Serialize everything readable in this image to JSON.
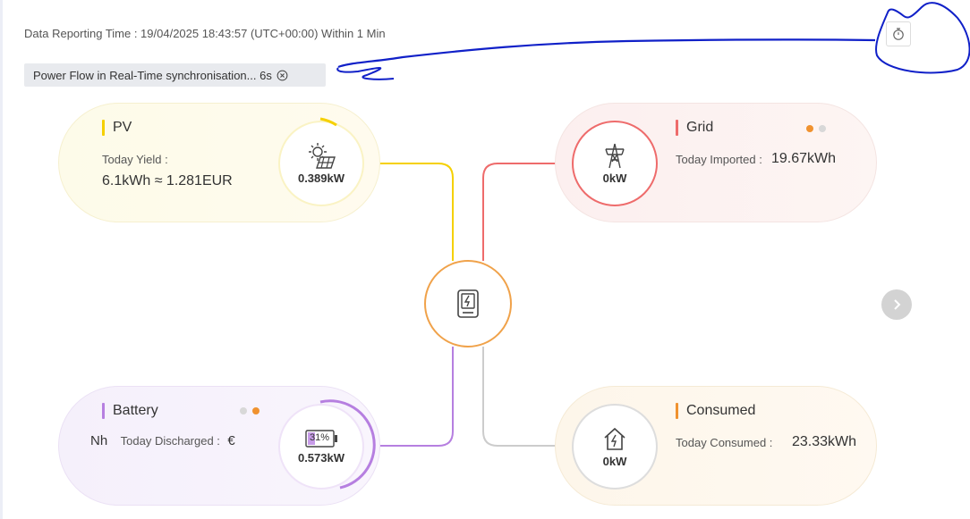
{
  "header": {
    "reporting_time": "Data Reporting Time :  19/04/2025 18:43:57 (UTC+00:00) Within 1 Min",
    "sync_label": "Power Flow in Real-Time synchronisation... 6s"
  },
  "pv": {
    "title": "PV",
    "label": "Today Yield :",
    "value": "6.1kWh ≈ 1.281EUR",
    "power": "0.389kW",
    "icon": "solar-panel-icon"
  },
  "grid": {
    "title": "Grid",
    "label": "Today Imported :",
    "value": "19.67kWh",
    "power": "0kW",
    "icon": "pylon-icon"
  },
  "battery": {
    "title": "Battery",
    "label_partial": "Nh",
    "label": "Today Discharged :",
    "value_partial": "€",
    "power": "0.573kW",
    "soc": "31%",
    "icon": "battery-icon"
  },
  "consumed": {
    "title": "Consumed",
    "label": "Today Consumed :",
    "value": "23.33kWh",
    "power": "0kW",
    "icon": "home-energy-icon"
  },
  "colors": {
    "pv": "#f5d000",
    "grid": "#ee6b6b",
    "battery": "#b67fe0",
    "consumed": "#f0922f",
    "inverter": "#f0a24a",
    "annotation": "#1020c8"
  }
}
